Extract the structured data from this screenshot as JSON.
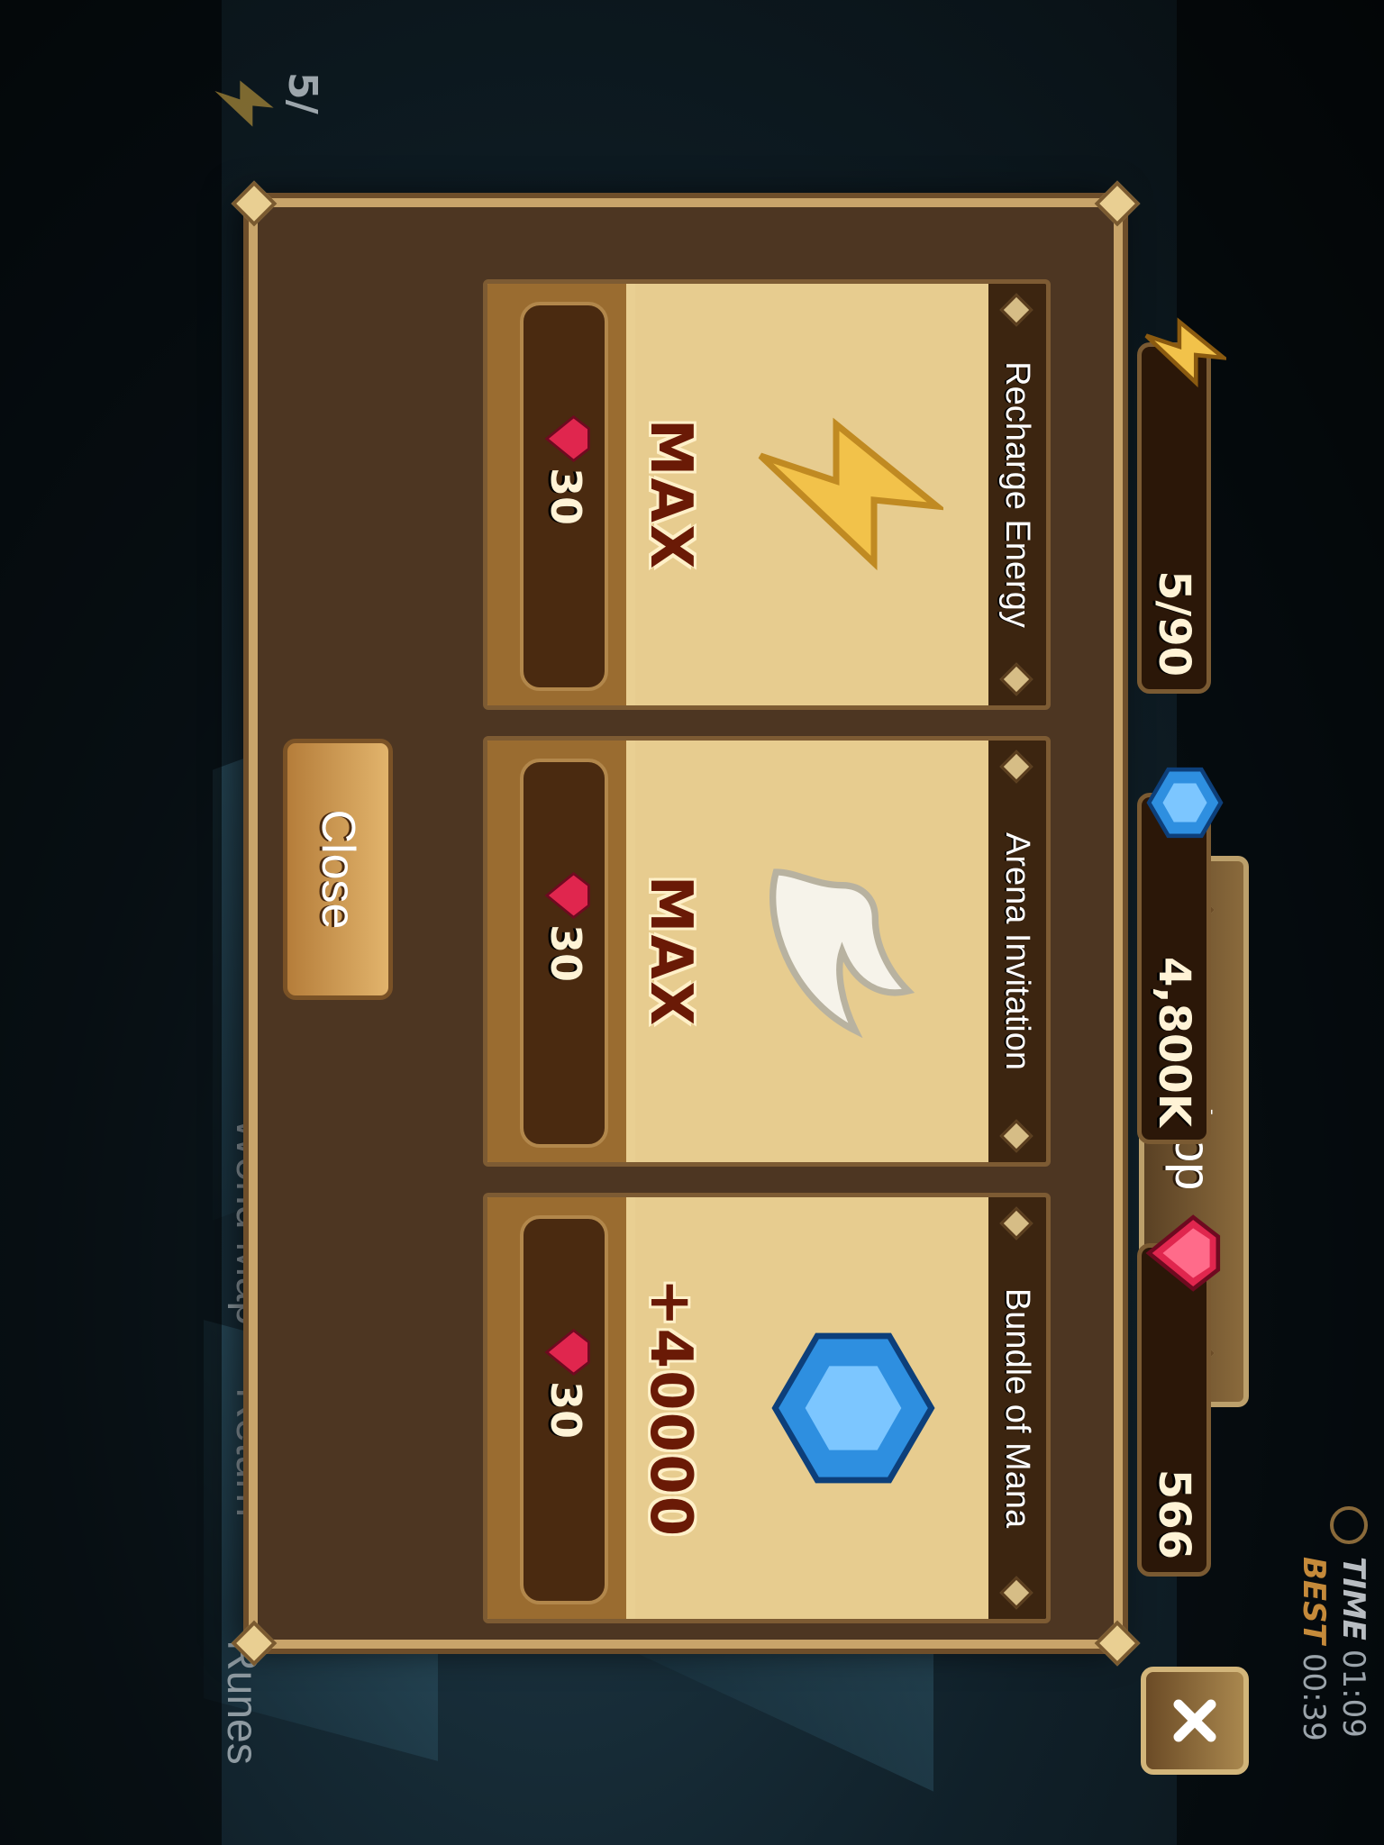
{
  "hud": {
    "time_label": "TIME",
    "time_value": "01:09",
    "best_label": "BEST",
    "best_value": "00:39",
    "energy_partial": "5/"
  },
  "background_menu": {
    "world_map": "World Map",
    "return": "Return",
    "runes": "Runes"
  },
  "shop": {
    "title": "Shop",
    "resources": {
      "energy": "5/90",
      "mana": "4,800K",
      "crystals": "566"
    },
    "items": [
      {
        "name": "Recharge Energy",
        "status": "MAX",
        "price": "30",
        "icon": "energy-bolt-icon"
      },
      {
        "name": "Arena Invitation",
        "status": "MAX",
        "price": "30",
        "icon": "wing-icon"
      },
      {
        "name": "Bundle of Mana",
        "status": "+40000",
        "price": "30",
        "icon": "mana-crystal-icon"
      }
    ],
    "close_label": "Close"
  },
  "colors": {
    "panel_brown": "#4d3622",
    "card_parchment": "#e9cf92",
    "status_text": "#6a1a06",
    "crystal_red": "#e0264e",
    "mana_blue": "#2e8fe0",
    "energy_gold": "#f2c24a"
  }
}
